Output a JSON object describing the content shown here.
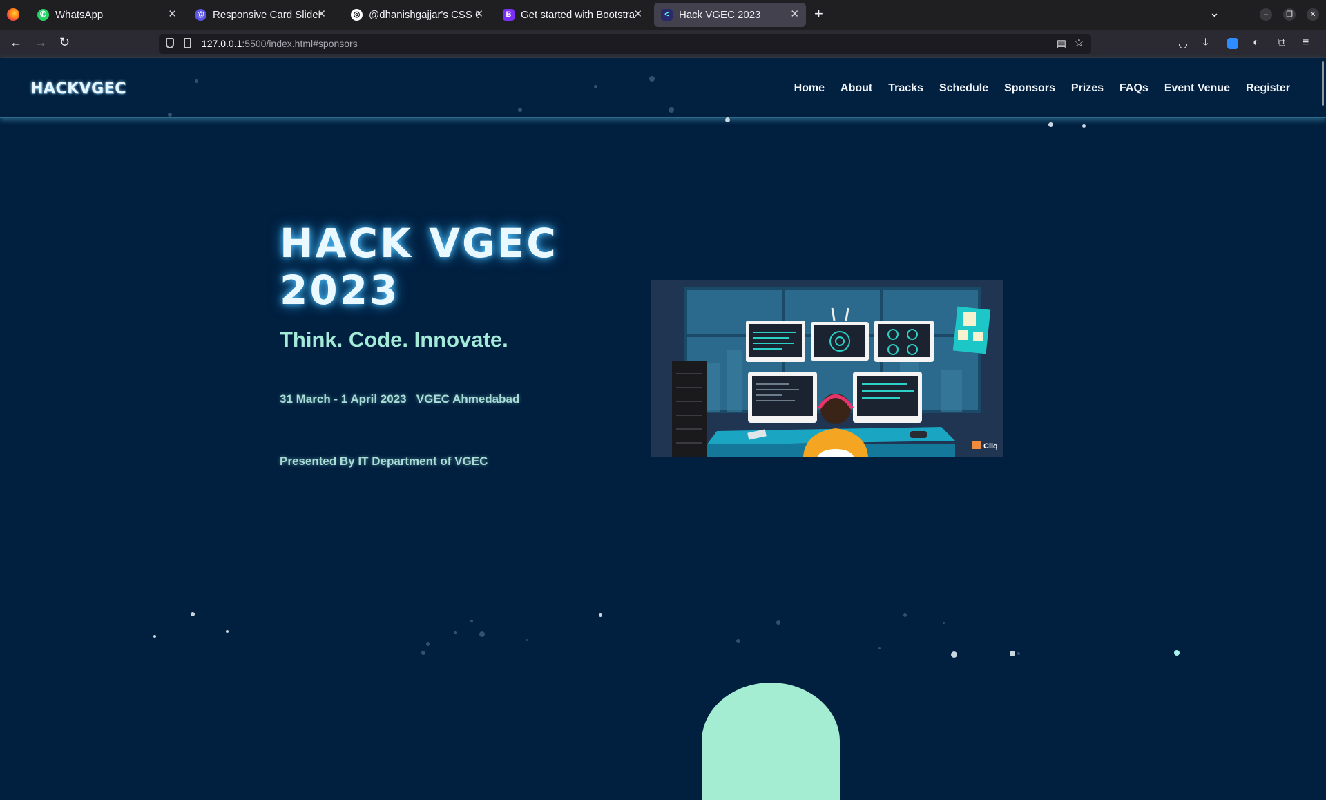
{
  "browser": {
    "tabs": [
      {
        "title": "WhatsApp",
        "icon": "whatsapp-icon",
        "active": false
      },
      {
        "title": "Responsive Card Slider in",
        "icon": "codepen-icon",
        "active": false
      },
      {
        "title": "@dhanishgajjar's CSS Cha",
        "icon": "github-icon",
        "active": false
      },
      {
        "title": "Get started with Bootstra",
        "icon": "bootstrap-icon",
        "active": false
      },
      {
        "title": "Hack VGEC 2023",
        "icon": "site-favicon-icon",
        "active": true
      }
    ],
    "url_host": "127.0.0.1",
    "url_rest": ":5500/index.html#sponsors"
  },
  "site": {
    "logo": "HACKVGEC",
    "menu": [
      "Home",
      "About",
      "Tracks",
      "Schedule",
      "Sponsors",
      "Prizes",
      "FAQs",
      "Event Venue",
      "Register"
    ],
    "hero": {
      "title_line1": "HACK VGEC",
      "title_line2": "2023",
      "tagline": "Think. Code. Innovate.",
      "date": "31 March - 1 April 2023",
      "venue": "VGEC Ahmedabad",
      "presented_by": "Presented By IT Department of VGEC",
      "illustration_watermark": "Cliq"
    }
  },
  "colors": {
    "background": "#011f3f",
    "accent_mint": "#a4ead9",
    "title_glow": "#4fc2ff"
  }
}
